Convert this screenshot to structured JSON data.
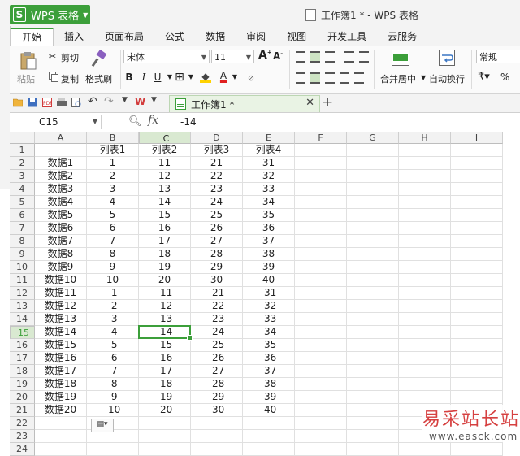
{
  "app": {
    "button_label": "WPS 表格",
    "logo_letter": "S",
    "window_title": "工作簿1 * - WPS 表格"
  },
  "ribbon_tabs": [
    "开始",
    "插入",
    "页面布局",
    "公式",
    "数据",
    "审阅",
    "视图",
    "开发工具",
    "云服务"
  ],
  "ribbon": {
    "paste": "粘贴",
    "cut": "剪切",
    "copy": "复制",
    "format_painter": "格式刷",
    "font_name": "宋体",
    "font_size": "11",
    "merge_center": "合并居中",
    "wrap_text": "自动换行",
    "number_format": "常规",
    "percent": "%"
  },
  "doc_tab": {
    "title": "工作簿1 *"
  },
  "formula_bar": {
    "name_box": "C15",
    "fx": "fx",
    "value": "-14"
  },
  "columns": [
    "A",
    "B",
    "C",
    "D",
    "E",
    "F",
    "G",
    "H",
    "I"
  ],
  "selected_column": "C",
  "selected_row": 15,
  "rows": [
    [
      "",
      "列表1",
      "列表2",
      "列表3",
      "列表4"
    ],
    [
      "数据1",
      "1",
      "11",
      "21",
      "31"
    ],
    [
      "数据2",
      "2",
      "12",
      "22",
      "32"
    ],
    [
      "数据3",
      "3",
      "13",
      "23",
      "33"
    ],
    [
      "数据4",
      "4",
      "14",
      "24",
      "34"
    ],
    [
      "数据5",
      "5",
      "15",
      "25",
      "35"
    ],
    [
      "数据6",
      "6",
      "16",
      "26",
      "36"
    ],
    [
      "数据7",
      "7",
      "17",
      "27",
      "37"
    ],
    [
      "数据8",
      "8",
      "18",
      "28",
      "38"
    ],
    [
      "数据9",
      "9",
      "19",
      "29",
      "39"
    ],
    [
      "数据10",
      "10",
      "20",
      "30",
      "40"
    ],
    [
      "数据11",
      "-1",
      "-11",
      "-21",
      "-31"
    ],
    [
      "数据12",
      "-2",
      "-12",
      "-22",
      "-32"
    ],
    [
      "数据13",
      "-3",
      "-13",
      "-23",
      "-33"
    ],
    [
      "数据14",
      "-4",
      "-14",
      "-24",
      "-34"
    ],
    [
      "数据15",
      "-5",
      "-15",
      "-25",
      "-35"
    ],
    [
      "数据16",
      "-6",
      "-16",
      "-26",
      "-36"
    ],
    [
      "数据17",
      "-7",
      "-17",
      "-27",
      "-37"
    ],
    [
      "数据18",
      "-8",
      "-18",
      "-28",
      "-38"
    ],
    [
      "数据19",
      "-9",
      "-19",
      "-29",
      "-39"
    ],
    [
      "数据20",
      "-10",
      "-20",
      "-30",
      "-40"
    ],
    [
      "",
      "",
      "",
      "",
      ""
    ],
    [
      "",
      "",
      "",
      "",
      ""
    ],
    [
      "",
      "",
      "",
      "",
      ""
    ]
  ],
  "watermark": {
    "text": "易采站长站",
    "url": "www.easck.com"
  },
  "colors": {
    "accent": "#3c9f3a",
    "selection": "#d9e9d1"
  }
}
